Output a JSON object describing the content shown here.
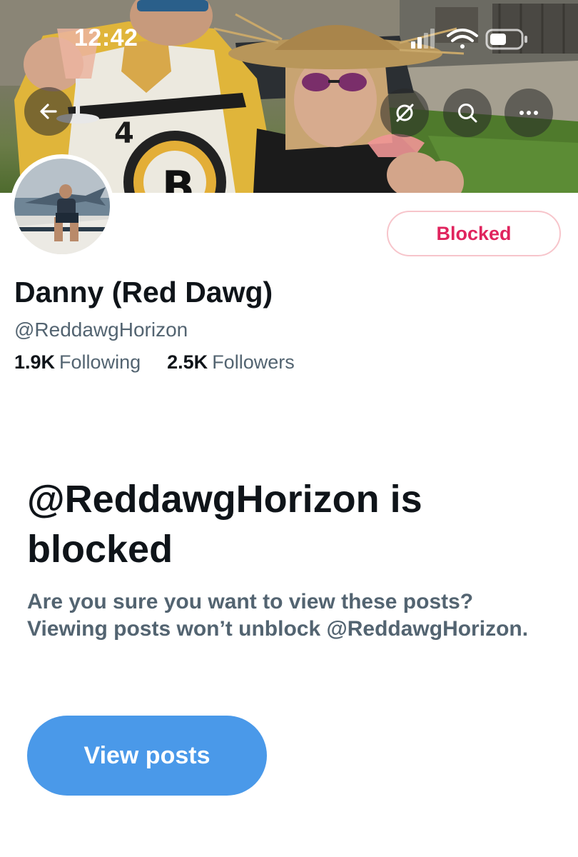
{
  "status_bar": {
    "time": "12:42",
    "icons": [
      "signal-icon",
      "wifi-icon",
      "battery-icon"
    ]
  },
  "header": {
    "buttons": [
      "back-arrow-icon",
      "no-retweets-icon",
      "search-icon",
      "more-icon"
    ]
  },
  "profile": {
    "display_name": "Danny (Red Dawg)",
    "handle": "@ReddawgHorizon",
    "following_count": "1.9K",
    "following_label": "Following",
    "followers_count": "2.5K",
    "followers_label": "Followers",
    "blocked_button_label": "Blocked"
  },
  "blocked_notice": {
    "title": "@ReddawgHorizon is blocked",
    "description": "Are you sure you want to view these posts? Viewing posts won’t unblock @ReddawgHorizon.",
    "view_posts_label": "View posts"
  },
  "colors": {
    "blocked_text": "#e0245e",
    "blocked_border": "#f7c5cb",
    "primary_button": "#4a99e9",
    "secondary_text": "#536471",
    "primary_text": "#0f1419"
  }
}
